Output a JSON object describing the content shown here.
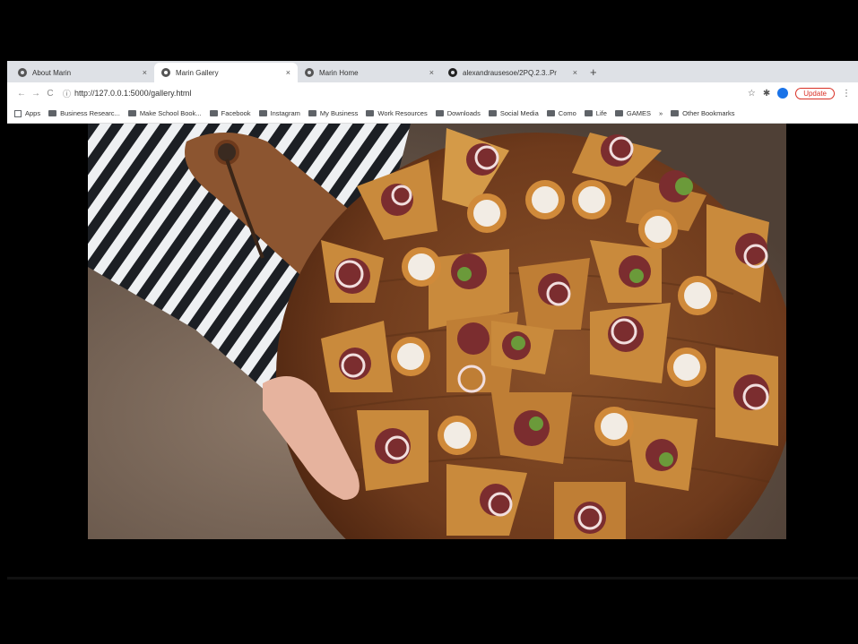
{
  "browser": {
    "tabs": [
      {
        "title": "About Marin",
        "active": false,
        "icon": "globe-icon"
      },
      {
        "title": "Marin Gallery",
        "active": true,
        "icon": "globe-icon"
      },
      {
        "title": "Marin Home",
        "active": false,
        "icon": "globe-icon"
      },
      {
        "title": "alexandrausesoe/2PQ.2.3..Pr",
        "active": false,
        "icon": "github-icon"
      }
    ],
    "new_tab_symbol": "+",
    "close_symbol": "×",
    "toolbar": {
      "back": "←",
      "forward": "→",
      "reload": "C",
      "info": "ⓘ",
      "url": "http://127.0.0.1:5000/gallery.html",
      "star": "☆",
      "extensions": "✱",
      "update_label": "Update",
      "menu": "⋮"
    },
    "bookmarks": [
      {
        "label": "Apps",
        "type": "apps"
      },
      {
        "label": "Business Researc...",
        "type": "folder"
      },
      {
        "label": "Make School Book...",
        "type": "folder"
      },
      {
        "label": "Facebook",
        "type": "folder"
      },
      {
        "label": "Instagram",
        "type": "folder"
      },
      {
        "label": "My Business",
        "type": "folder"
      },
      {
        "label": "Work Resources",
        "type": "folder"
      },
      {
        "label": "Downloads",
        "type": "folder"
      },
      {
        "label": "Social Media",
        "type": "folder"
      },
      {
        "label": "Como",
        "type": "folder"
      },
      {
        "label": "Life",
        "type": "folder"
      },
      {
        "label": "GAMES",
        "type": "folder"
      },
      {
        "label": "»",
        "type": "more"
      },
      {
        "label": "Other Bookmarks",
        "type": "folder"
      }
    ]
  },
  "colors": {
    "tabstrip": "#dee1e6",
    "accent": "#1a73e8",
    "update": "#d93025",
    "board": "#7a4422",
    "stripe_dark": "#1c1f24",
    "stripe_light": "#eef0f2",
    "backdrop": "#5e4e44"
  }
}
